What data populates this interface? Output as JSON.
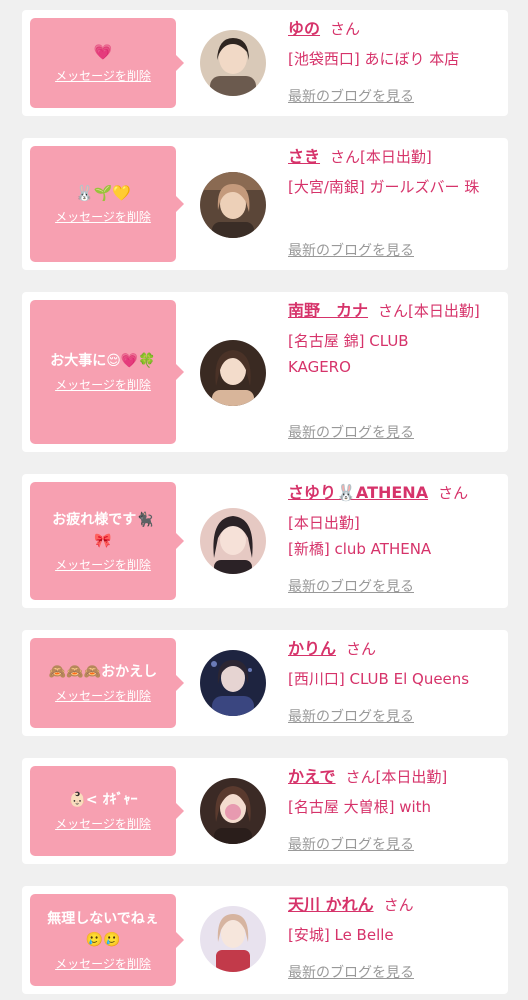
{
  "common": {
    "delete_label": "メッセージを削除",
    "blog_label": "最新のブログを見る",
    "san_label": "さん"
  },
  "colors": {
    "accent": "#d6336a",
    "bubble": "#f7a0b1",
    "muted": "#999999"
  },
  "cards": [
    {
      "message": "💗",
      "name": "ゆの",
      "name_suffix": "",
      "shop_text": "[池袋西口] あにぼり 本店",
      "avatar_colors": [
        "#6b5a4e",
        "#d9c9b8"
      ]
    },
    {
      "message": "🐰🌱💛",
      "name": "さき",
      "name_suffix": "[本日出勤]",
      "shop_text": "[大宮/南銀] ガールズバー 珠",
      "avatar_colors": [
        "#5b4638",
        "#c49a7c"
      ]
    },
    {
      "message": "お大事に😌💗🍀",
      "name": "南野　カナ",
      "name_suffix": "[本日出勤]",
      "shop_text": "[名古屋 錦] CLUB KAGERO",
      "avatar_colors": [
        "#3a2a22",
        "#d8b59a"
      ]
    },
    {
      "message": "お疲れ様です🐈‍⬛\n🎀",
      "name": "さゆり🐰ATHENA",
      "name_suffix": "",
      "shop_text": "[本日出勤]\n[新橋] club ATHENA",
      "avatar_colors": [
        "#2b2226",
        "#e6c9c3"
      ]
    },
    {
      "message": "🙈🙈🙈おかえし",
      "name": "かりん",
      "name_suffix": "",
      "shop_text": "[西川口] CLUB El Queens",
      "avatar_colors": [
        "#1e2440",
        "#6a7bb8"
      ]
    },
    {
      "message": "👶🏻< ｵｷﾞｬｰ",
      "name": "かえで",
      "name_suffix": "[本日出勤]",
      "shop_text": "[名古屋 大曽根] with",
      "avatar_colors": [
        "#3b2a25",
        "#e79ab0"
      ]
    },
    {
      "message": "無理しないでねぇ\n🥲🥲",
      "name": "天川 かれん",
      "name_suffix": "",
      "shop_text": "[安城] Le Belle",
      "avatar_colors": [
        "#e8e2ee",
        "#c23a4a"
      ]
    }
  ]
}
